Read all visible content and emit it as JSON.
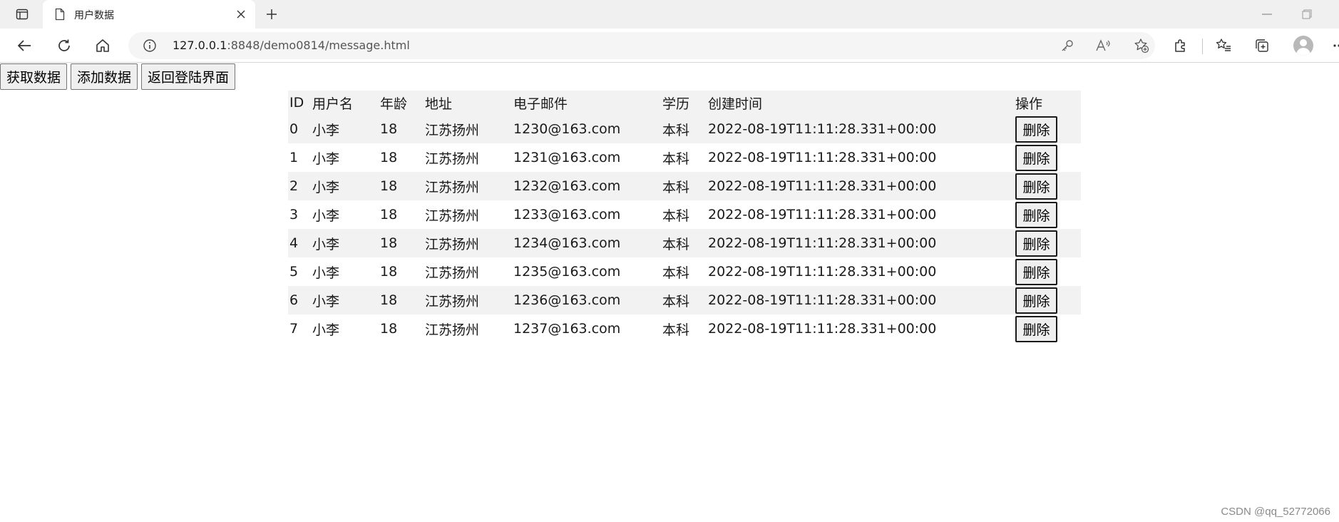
{
  "browser": {
    "tab_title": "用户数据",
    "url_host": "127.0.0.1",
    "url_rest": ":8848/demo0814/message.html"
  },
  "page": {
    "buttons": [
      "获取数据",
      "添加数据",
      "返回登陆界面"
    ],
    "table": {
      "headers": [
        "ID",
        "用户名",
        "年龄",
        "地址",
        "电子邮件",
        "学历",
        "创建时间",
        "操作"
      ],
      "delete_label": "删除",
      "rows": [
        {
          "id": "0",
          "name": "小李",
          "age": "18",
          "address": "江苏扬州",
          "email": "1230@163.com",
          "edu": "本科",
          "created": "2022-08-19T11:11:28.331+00:00"
        },
        {
          "id": "1",
          "name": "小李",
          "age": "18",
          "address": "江苏扬州",
          "email": "1231@163.com",
          "edu": "本科",
          "created": "2022-08-19T11:11:28.331+00:00"
        },
        {
          "id": "2",
          "name": "小李",
          "age": "18",
          "address": "江苏扬州",
          "email": "1232@163.com",
          "edu": "本科",
          "created": "2022-08-19T11:11:28.331+00:00"
        },
        {
          "id": "3",
          "name": "小李",
          "age": "18",
          "address": "江苏扬州",
          "email": "1233@163.com",
          "edu": "本科",
          "created": "2022-08-19T11:11:28.331+00:00"
        },
        {
          "id": "4",
          "name": "小李",
          "age": "18",
          "address": "江苏扬州",
          "email": "1234@163.com",
          "edu": "本科",
          "created": "2022-08-19T11:11:28.331+00:00"
        },
        {
          "id": "5",
          "name": "小李",
          "age": "18",
          "address": "江苏扬州",
          "email": "1235@163.com",
          "edu": "本科",
          "created": "2022-08-19T11:11:28.331+00:00"
        },
        {
          "id": "6",
          "name": "小李",
          "age": "18",
          "address": "江苏扬州",
          "email": "1236@163.com",
          "edu": "本科",
          "created": "2022-08-19T11:11:28.331+00:00"
        },
        {
          "id": "7",
          "name": "小李",
          "age": "18",
          "address": "江苏扬州",
          "email": "1237@163.com",
          "edu": "本科",
          "created": "2022-08-19T11:11:28.331+00:00"
        }
      ]
    }
  },
  "watermark": "CSDN @qq_52772066"
}
